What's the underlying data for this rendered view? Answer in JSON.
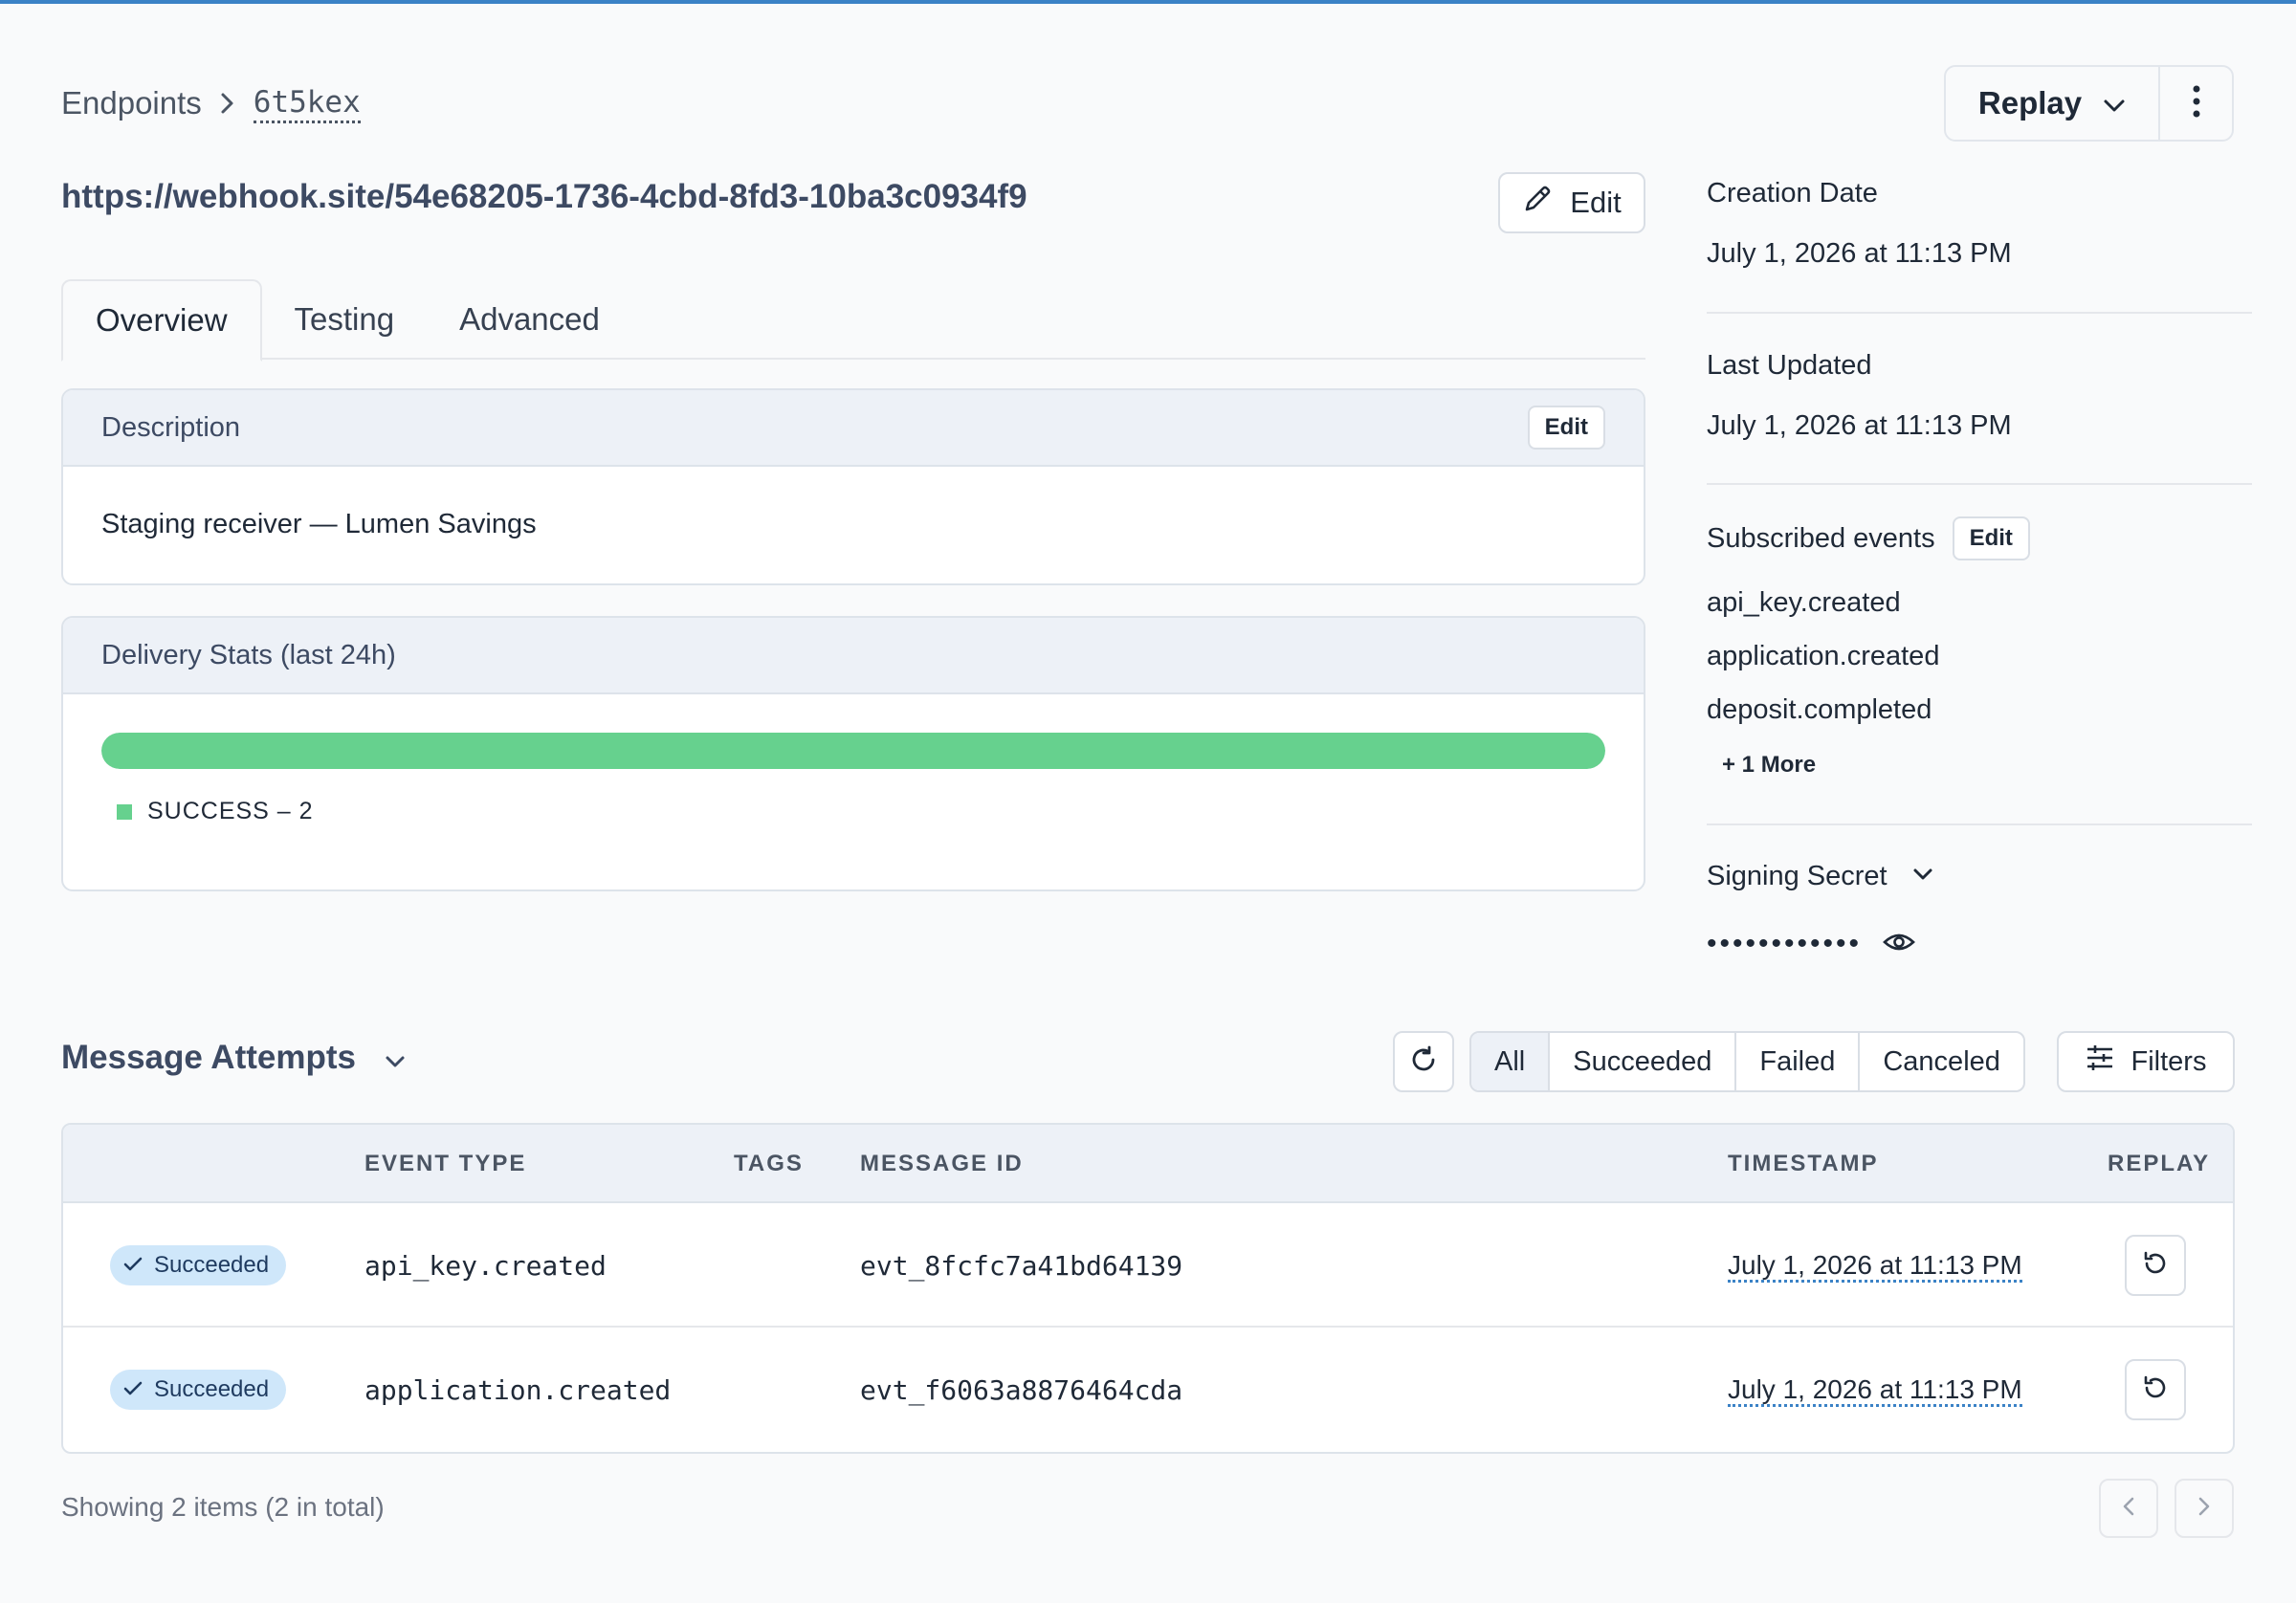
{
  "breadcrumb": {
    "root": "Endpoints",
    "current": "6t5kex"
  },
  "header": {
    "replay_label": "Replay",
    "url": "https://webhook.site/54e68205-1736-4cbd-8fd3-10ba3c0934f9",
    "edit_label": "Edit"
  },
  "tabs": [
    {
      "label": "Overview"
    },
    {
      "label": "Testing"
    },
    {
      "label": "Advanced"
    }
  ],
  "description": {
    "title": "Description",
    "edit_label": "Edit",
    "text": "Staging receiver — Lumen Savings"
  },
  "delivery_stats": {
    "title": "Delivery Stats (last 24h)",
    "success_fraction": 1.0,
    "legend": "SUCCESS – 2",
    "color": "#66d18e"
  },
  "side": {
    "creation_label": "Creation Date",
    "creation_value": "July 1, 2026 at 11:13 PM",
    "updated_label": "Last Updated",
    "updated_value": "July 1, 2026 at 11:13 PM",
    "events_label": "Subscribed events",
    "events_edit": "Edit",
    "events": [
      "api_key.created",
      "application.created",
      "deposit.completed"
    ],
    "more_label": "+ 1 More",
    "secret_label": "Signing Secret",
    "secret_masked": "••••••••••••"
  },
  "attempts": {
    "title": "Message Attempts",
    "filters": [
      "All",
      "Succeeded",
      "Failed",
      "Canceled"
    ],
    "filters_label": "Filters",
    "columns": {
      "event_type": "EVENT TYPE",
      "tags": "TAGS",
      "message_id": "MESSAGE ID",
      "timestamp": "TIMESTAMP",
      "replay": "REPLAY"
    },
    "rows": [
      {
        "status": "Succeeded",
        "event_type": "api_key.created",
        "message_id": "evt_8fcfc7a41bd64139",
        "timestamp": "July 1, 2026 at 11:13 PM"
      },
      {
        "status": "Succeeded",
        "event_type": "application.created",
        "message_id": "evt_f6063a8876464cda",
        "timestamp": "July 1, 2026 at 11:13 PM"
      }
    ],
    "footer": "Showing 2 items (2 in total)"
  },
  "colors": {
    "accent": "#3b82c6",
    "success": "#66d18e",
    "badge_bg": "#cfe7fa"
  }
}
